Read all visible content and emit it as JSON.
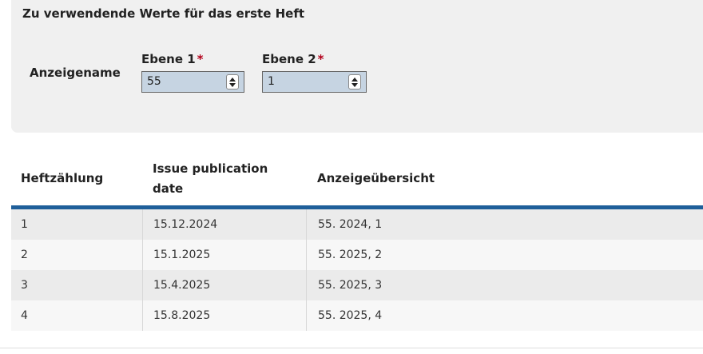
{
  "panel": {
    "title": "Zu verwendende Werte für das erste Heft",
    "row_label": "Anzeigename",
    "fields": [
      {
        "label": "Ebene 1",
        "required_mark": "*",
        "value": "55"
      },
      {
        "label": "Ebene 2",
        "required_mark": "*",
        "value": "1"
      }
    ]
  },
  "table": {
    "headers": [
      "Heftzählung",
      "Issue publication date",
      "Anzeigeübersicht"
    ],
    "rows": [
      [
        "1",
        "15.12.2024",
        "55. 2024, 1"
      ],
      [
        "2",
        "15.1.2025",
        "55. 2025, 2"
      ],
      [
        "3",
        "15.4.2025",
        "55. 2025, 3"
      ],
      [
        "4",
        "15.8.2025",
        "55. 2025, 4"
      ]
    ]
  },
  "colors": {
    "panel_bg": "#f0f0f0",
    "input_bg": "#c6d4e2",
    "header_underline": "#1f5f9a",
    "required": "#b3001b"
  }
}
